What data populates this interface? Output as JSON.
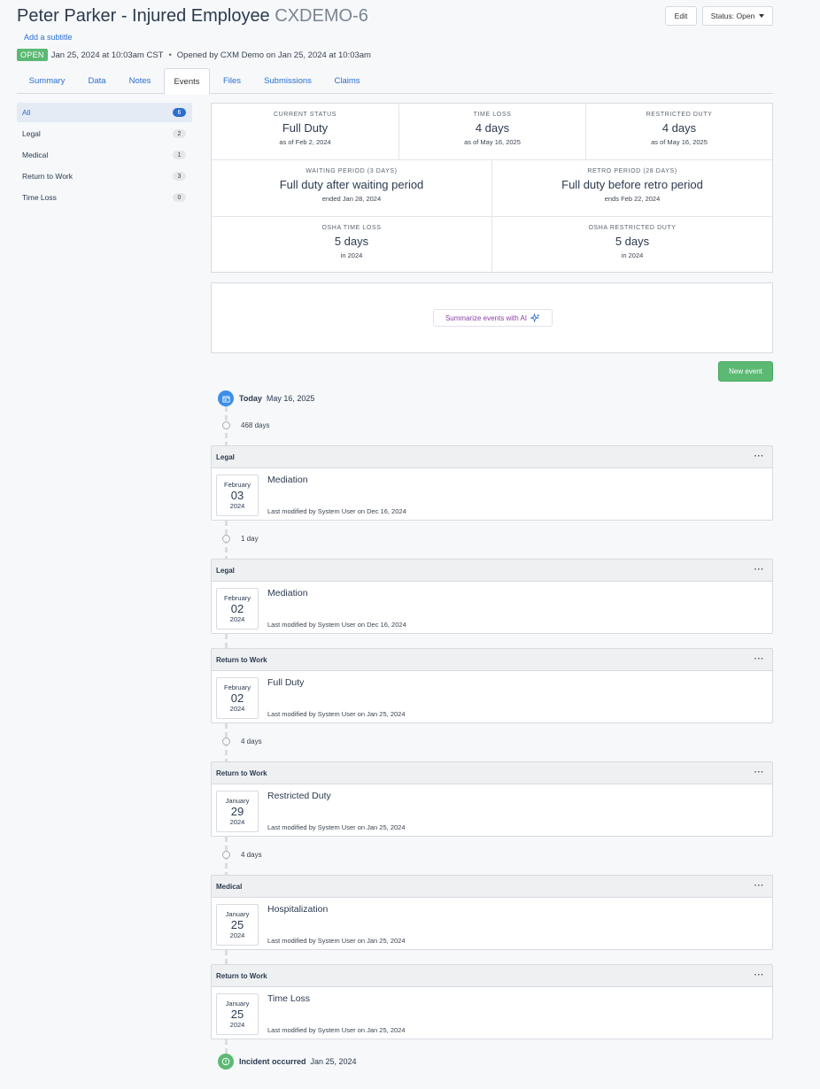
{
  "header": {
    "title": "Peter Parker - Injured Employee",
    "case_id": "CXDEMO-6",
    "add_subtitle": "Add a subtitle",
    "status_badge": "OPEN",
    "opened_time": "Jan 25, 2024 at 10:03am CST",
    "opened_by": "Opened by CXM Demo on Jan 25, 2024 at 10:03am",
    "edit_label": "Edit",
    "status_label": "Status: Open"
  },
  "tabs": [
    {
      "label": "Summary"
    },
    {
      "label": "Data"
    },
    {
      "label": "Notes"
    },
    {
      "label": "Events"
    },
    {
      "label": "Files"
    },
    {
      "label": "Submissions"
    },
    {
      "label": "Claims"
    }
  ],
  "sidebar": {
    "items": [
      {
        "label": "All",
        "count": "6"
      },
      {
        "label": "Legal",
        "count": "2"
      },
      {
        "label": "Medical",
        "count": "1"
      },
      {
        "label": "Return to Work",
        "count": "3"
      },
      {
        "label": "Time Loss",
        "count": "0"
      }
    ]
  },
  "stats": [
    {
      "label": "CURRENT STATUS",
      "value": "Full Duty",
      "sub": "as of Feb 2, 2024"
    },
    {
      "label": "TIME LOSS",
      "value": "4 days",
      "sub": "as of May 16, 2025"
    },
    {
      "label": "RESTRICTED DUTY",
      "value": "4 days",
      "sub": "as of May 16, 2025"
    },
    {
      "label": "WAITING PERIOD (3 DAYS)",
      "value": "Full duty after waiting period",
      "sub": "ended Jan 28, 2024"
    },
    {
      "label": "RETRO PERIOD (28 DAYS)",
      "value": "Full duty before retro period",
      "sub": "ends Feb 22, 2024"
    },
    {
      "label": "OSHA TIME LOSS",
      "value": "5 days",
      "sub": "in 2024"
    },
    {
      "label": "OSHA RESTRICTED DUTY",
      "value": "5 days",
      "sub": "in 2024"
    }
  ],
  "ai": {
    "label": "Summarize events with AI"
  },
  "new_event_label": "New event",
  "timeline": {
    "today_label": "Today",
    "today_date": "May 16, 2025",
    "gaps": [
      "468 days",
      "1 day",
      "4 days",
      "4 days"
    ],
    "incident_label": "Incident occurred",
    "incident_date": "Jan 25, 2024"
  },
  "events": [
    {
      "category": "Legal",
      "month": "February",
      "day": "03",
      "year": "2024",
      "title": "Mediation",
      "meta": "Last modified by System User on Dec 16, 2024"
    },
    {
      "category": "Legal",
      "month": "February",
      "day": "02",
      "year": "2024",
      "title": "Mediation",
      "meta": "Last modified by System User on Dec 16, 2024"
    },
    {
      "category": "Return to Work",
      "month": "February",
      "day": "02",
      "year": "2024",
      "title": "Full Duty",
      "meta": "Last modified by System User on Jan 25, 2024"
    },
    {
      "category": "Return to Work",
      "month": "January",
      "day": "29",
      "year": "2024",
      "title": "Restricted Duty",
      "meta": "Last modified by System User on Jan 25, 2024"
    },
    {
      "category": "Medical",
      "month": "January",
      "day": "25",
      "year": "2024",
      "title": "Hospitalization",
      "meta": "Last modified by System User on Jan 25, 2024"
    },
    {
      "category": "Return to Work",
      "month": "January",
      "day": "25",
      "year": "2024",
      "title": "Time Loss",
      "meta": "Last modified by System User on Jan 25, 2024"
    }
  ],
  "more_label": "···",
  "colors": {
    "accent": "#2a6fcf",
    "success": "#5cb974",
    "today_icon": "#3d8ee8",
    "ai": "#8a3fa4"
  }
}
